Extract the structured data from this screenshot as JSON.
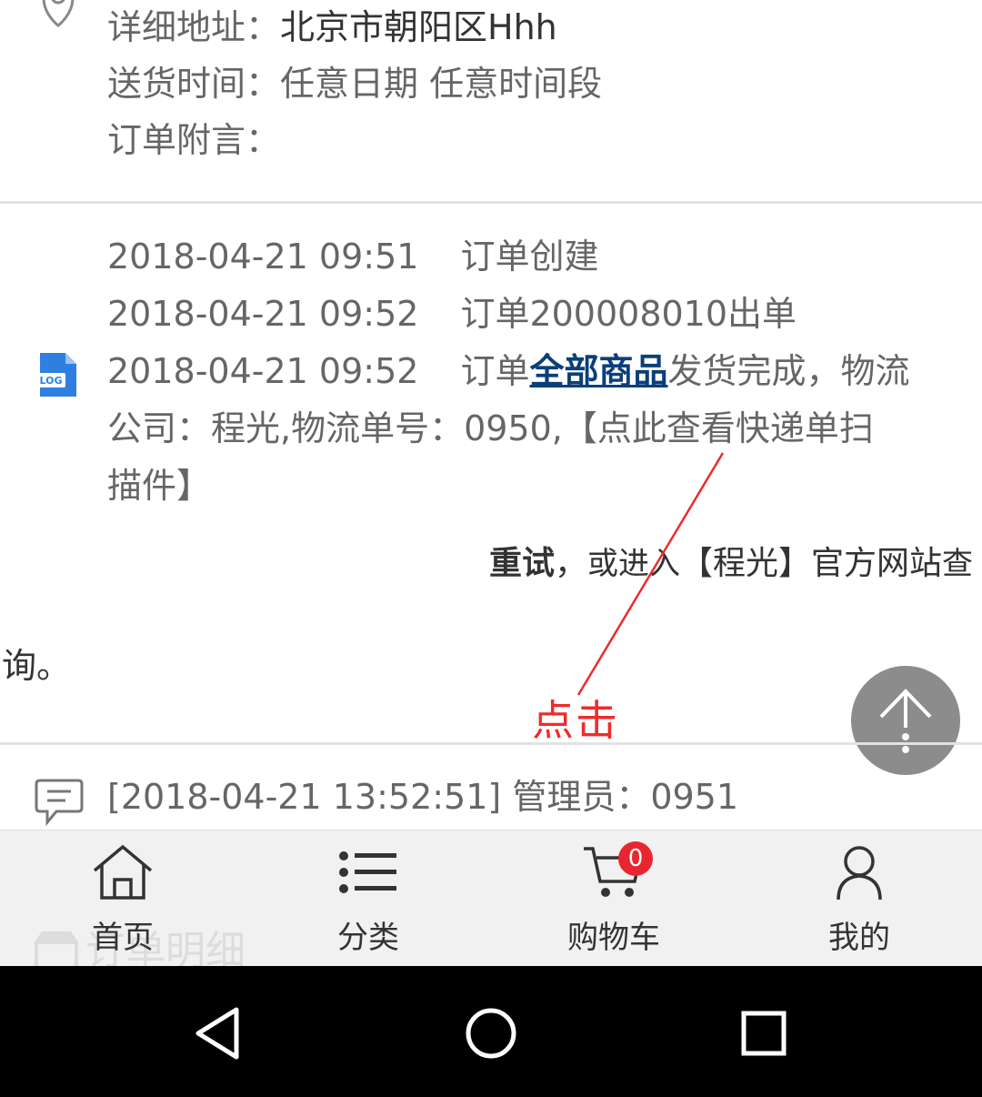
{
  "address": {
    "detail_label": "详细地址：",
    "detail_value": "北京市朝阳区Hhh",
    "delivery_label": "送货时间：",
    "delivery_value": "任意日期 任意时间段",
    "note_label": "订单附言："
  },
  "log": {
    "entries": [
      {
        "time": "2018-04-21 09:51",
        "text": "订单创建"
      },
      {
        "time": "2018-04-21 09:52",
        "text": "订单200008010出单"
      },
      {
        "time": "2018-04-21 09:52",
        "prefix": "订单",
        "link": "全部商品",
        "suffix": "发货完成，物流"
      }
    ],
    "continuation_1": "公司：程光,物流单号：0950,【点此查看快递单扫",
    "continuation_2": "描件】",
    "retry_bold": "重试",
    "retry_comma": "，",
    "retry_mid": "或进入",
    "retry_company": "【程光】官方网站",
    "retry_tail": "查",
    "retry_last": "询。"
  },
  "annotation": {
    "label": "点击",
    "color": "#ee2b2b"
  },
  "message": {
    "text": "[2018-04-21 13:52:51] 管理员：0951"
  },
  "background_header": {
    "label": "订单明细"
  },
  "tabbar": {
    "tabs": [
      {
        "label": "首页",
        "icon": "home-icon"
      },
      {
        "label": "分类",
        "icon": "list-icon"
      },
      {
        "label": "购物车",
        "icon": "cart-icon"
      },
      {
        "label": "我的",
        "icon": "user-icon"
      }
    ],
    "cart_badge": "0",
    "badge_color": "#e8262f"
  },
  "navbar": {
    "buttons": [
      "back-icon",
      "home-circle-icon",
      "recents-icon"
    ]
  }
}
